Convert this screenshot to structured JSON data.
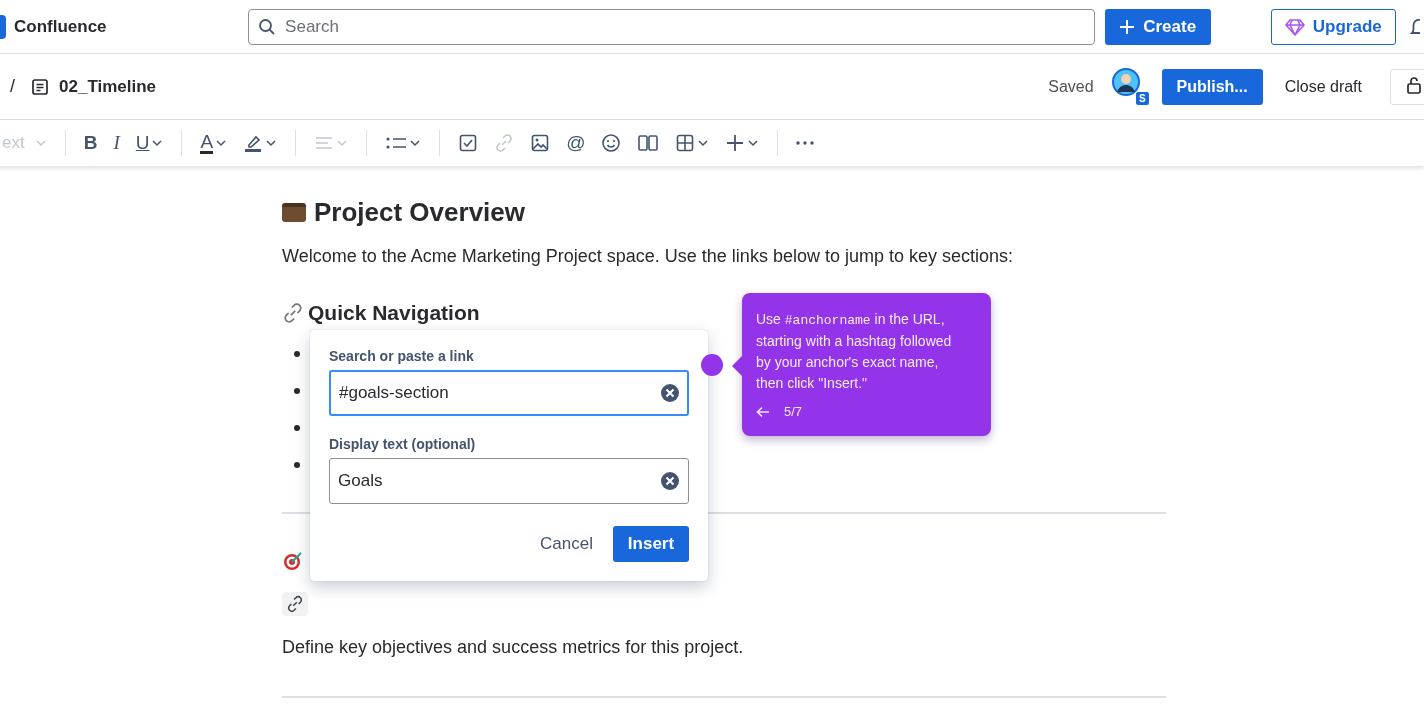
{
  "topbar": {
    "product": "Confluence",
    "search": {
      "placeholder": "Search"
    },
    "create": "Create",
    "upgrade": "Upgrade"
  },
  "page_bar": {
    "separator": "/",
    "title": "02_Timeline",
    "status": "Saved",
    "avatar_badge": "S",
    "publish": "Publish...",
    "close_draft": "Close draft"
  },
  "toolbar": [
    {
      "kind": "text",
      "label": "ext",
      "dropdown": true,
      "disabled": true
    },
    {
      "kind": "sep"
    },
    {
      "kind": "bold",
      "label": "B",
      "dropdown": false,
      "disabled": false
    },
    {
      "kind": "italic",
      "label": "I",
      "dropdown": false,
      "disabled": false
    },
    {
      "kind": "underline",
      "label": "U",
      "dropdown": true,
      "disabled": false
    },
    {
      "kind": "sep"
    },
    {
      "kind": "fontcolor",
      "label": "A",
      "dropdown": true,
      "disabled": false
    },
    {
      "kind": "highlight",
      "dropdown": true,
      "disabled": false
    },
    {
      "kind": "sep"
    },
    {
      "kind": "align",
      "dropdown": true,
      "disabled": true
    },
    {
      "kind": "sep"
    },
    {
      "kind": "list",
      "dropdown": true,
      "disabled": false
    },
    {
      "kind": "sep"
    },
    {
      "kind": "task",
      "dropdown": false,
      "disabled": false
    },
    {
      "kind": "link",
      "dropdown": false,
      "disabled": true
    },
    {
      "kind": "image",
      "dropdown": false,
      "disabled": false
    },
    {
      "kind": "mention",
      "label": "@",
      "dropdown": false,
      "disabled": false
    },
    {
      "kind": "emoji",
      "dropdown": false,
      "disabled": false
    },
    {
      "kind": "columns",
      "dropdown": false,
      "disabled": false
    },
    {
      "kind": "table",
      "dropdown": true,
      "disabled": false
    },
    {
      "kind": "plus",
      "dropdown": true,
      "disabled": false
    },
    {
      "kind": "sep"
    },
    {
      "kind": "more",
      "dropdown": false,
      "disabled": false
    }
  ],
  "content": {
    "title": "Project Overview",
    "intro": "Welcome to the Acme Marketing Project space. Use the links below to jump to key sections:",
    "nav_heading": "Quick Navigation",
    "bullets": [
      {
        "kind": "bullet"
      },
      {
        "kind": "bullet"
      },
      {
        "kind": "bullet"
      },
      {
        "kind": "bullet"
      }
    ],
    "goals_text": "Define key objectives and success metrics for this project."
  },
  "link_dialog": {
    "url_label": "Search or paste a link",
    "url_value": "#goals-section",
    "url_focused": true,
    "text_label": "Display text (optional)",
    "text_value": "Goals",
    "cancel": "Cancel",
    "insert": "Insert"
  },
  "guide": {
    "text_before": "Use ",
    "code": "#anchorname",
    "text_after": " in the URL, starting with a hashtag followed by your anchor's exact name, then click \"Insert.\"",
    "step": "5/7"
  }
}
